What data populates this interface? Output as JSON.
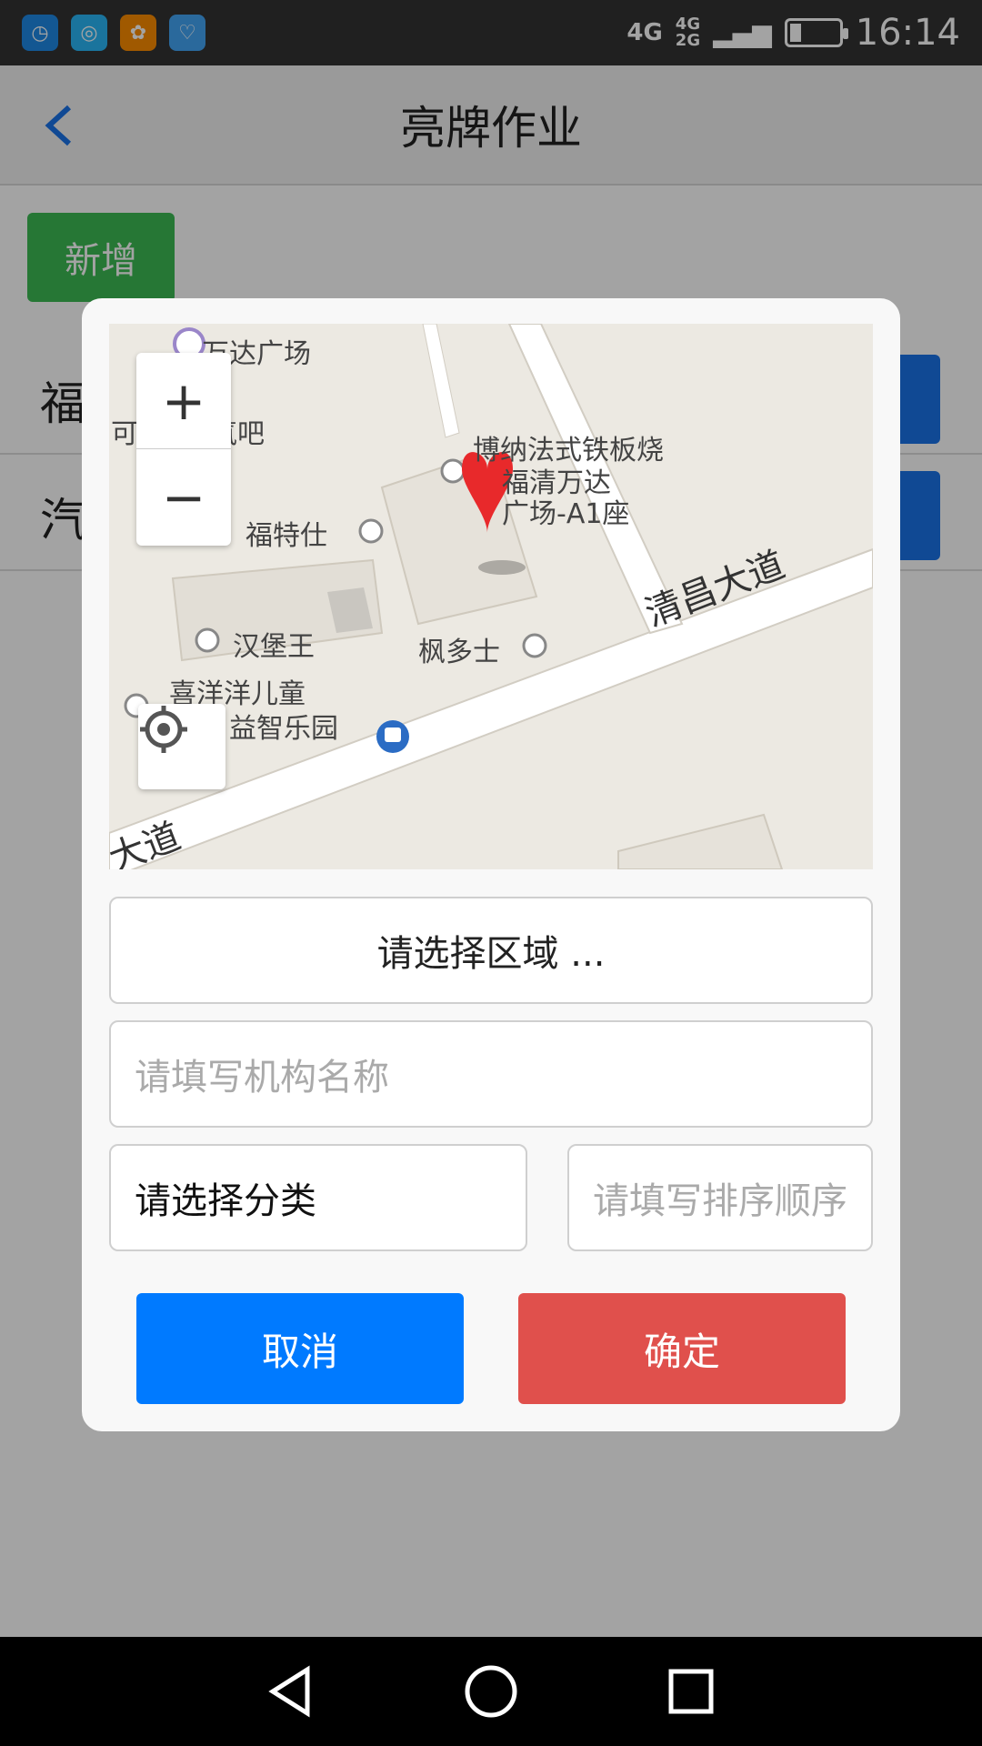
{
  "status_bar": {
    "time": "16:14",
    "network_top": "4G",
    "network_second": "4G",
    "network_third": "2G",
    "apps": [
      "clock-app-icon",
      "browser-app-icon",
      "game-app-icon",
      "health-app-icon"
    ]
  },
  "navbar": {
    "title": "亮牌作业",
    "back_icon": "chevron-left-icon"
  },
  "main": {
    "add_label": "新增",
    "rows": [
      {
        "label": "福"
      },
      {
        "label": "汽"
      }
    ]
  },
  "dialog": {
    "map": {
      "labels": [
        "万达广场",
        "可d果蔬氧吧",
        "博纳法式铁板烧",
        "福清万达",
        "广场-A1座",
        "福特仕",
        "汉堡王",
        "枫多士",
        "喜洋洋儿童",
        "益智乐园"
      ],
      "road_main": "清昌大道",
      "road_corner": "大道",
      "zoom_in": "+",
      "zoom_out": "−"
    },
    "area_select": "请选择区域 ...",
    "org_placeholder": "请填写机构名称",
    "category_select": "请选择分类",
    "sort_placeholder": "请填写排序顺序",
    "cancel_label": "取消",
    "confirm_label": "确定"
  },
  "colors": {
    "primary": "#007aff",
    "danger": "#e0504c",
    "success": "#3cba54"
  }
}
